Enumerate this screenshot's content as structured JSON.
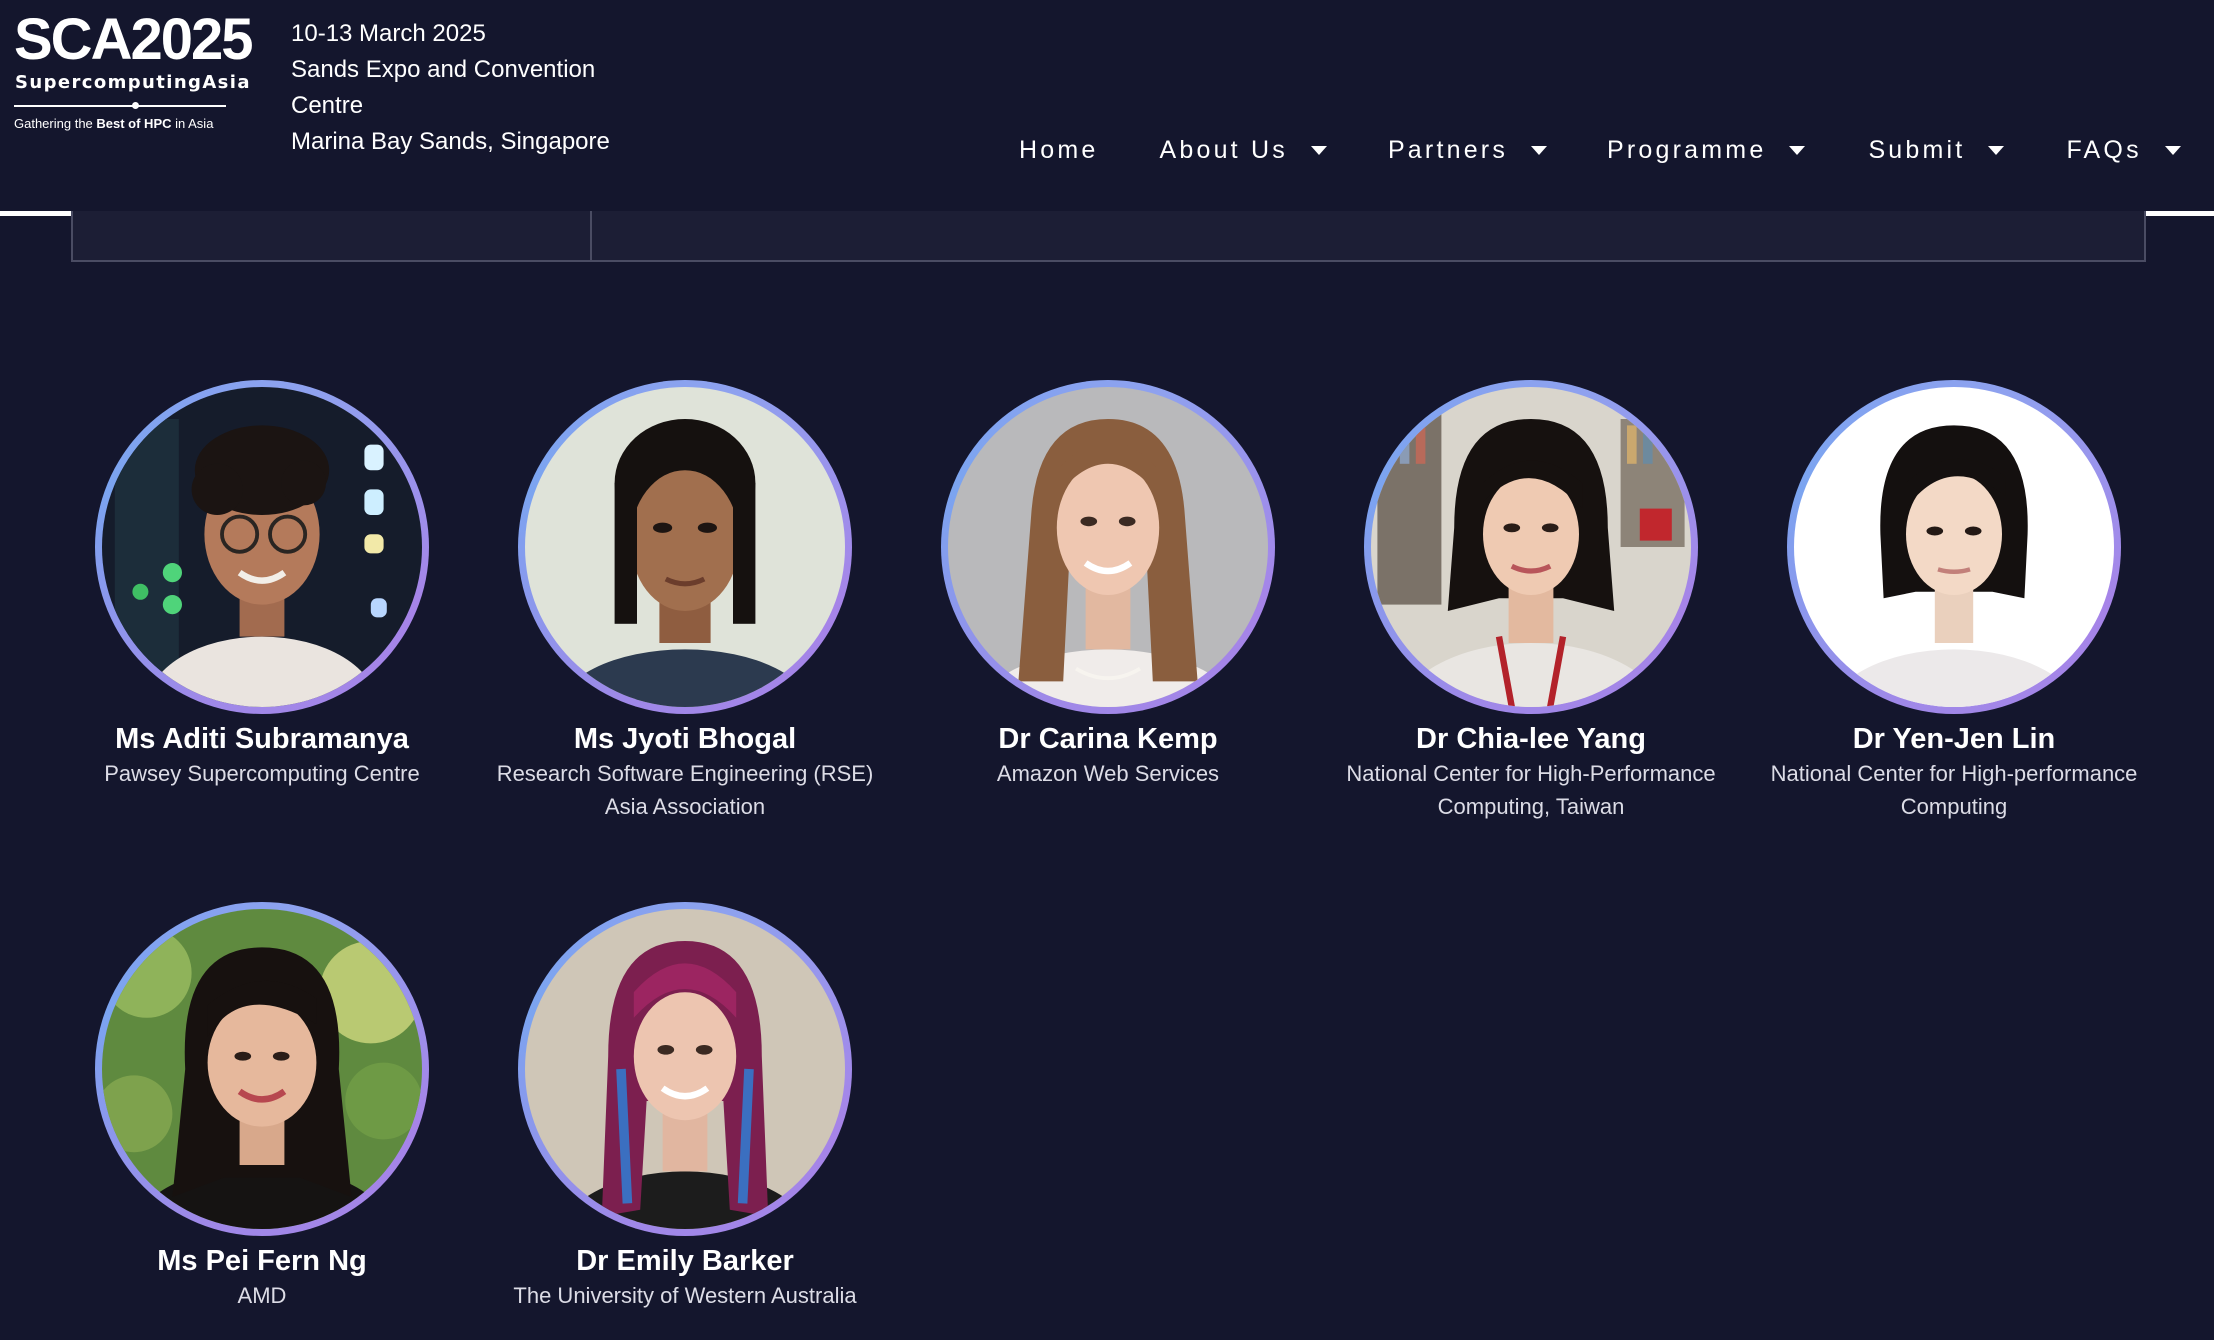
{
  "logo": {
    "main": "SCA2025",
    "sub": "SupercomputingAsia",
    "tagline_prefix": "Gathering the ",
    "tagline_bold": "Best of HPC",
    "tagline_suffix": " in Asia"
  },
  "event": {
    "dates": "10-13 March 2025",
    "venue_line1": "Sands Expo and Convention",
    "venue_line2": "Centre",
    "location": "Marina Bay Sands, Singapore"
  },
  "nav": {
    "home": "Home",
    "about": "About Us",
    "partners": "Partners",
    "programme": "Programme",
    "submit": "Submit",
    "faqs": "FAQs"
  },
  "speakers": [
    {
      "name": "Ms Aditi Subramanya",
      "org": "Pawsey Supercomputing Centre"
    },
    {
      "name": "Ms Jyoti Bhogal",
      "org": "Research Software Engineering (RSE) Asia Association"
    },
    {
      "name": "Dr Carina Kemp",
      "org": "Amazon Web Services"
    },
    {
      "name": "Dr Chia-lee Yang",
      "org": "National Center for High-Performance Computing, Taiwan"
    },
    {
      "name": "Dr Yen-Jen Lin",
      "org": "National Center for High-performance Computing"
    },
    {
      "name": "Ms Pei Fern Ng",
      "org": "AMD"
    },
    {
      "name": "Dr Emily Barker",
      "org": "The University of Western Australia"
    }
  ],
  "colors": {
    "background": "#14162d",
    "ring_purple": "#a684e8",
    "ring_blue": "#7ba4f0",
    "org_text": "#dcdce6"
  }
}
